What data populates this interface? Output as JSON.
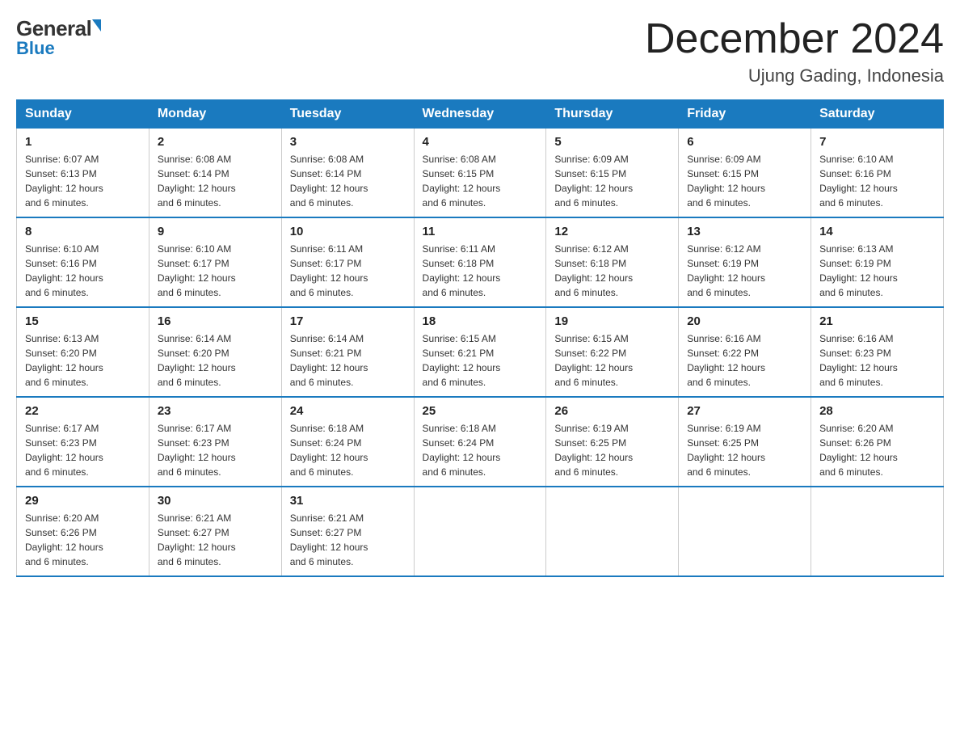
{
  "header": {
    "logo_top": "General",
    "logo_bottom": "Blue",
    "month_title": "December 2024",
    "location": "Ujung Gading, Indonesia"
  },
  "days_of_week": [
    "Sunday",
    "Monday",
    "Tuesday",
    "Wednesday",
    "Thursday",
    "Friday",
    "Saturday"
  ],
  "weeks": [
    [
      {
        "day": "1",
        "sunrise": "6:07 AM",
        "sunset": "6:13 PM",
        "daylight": "12 hours and 6 minutes."
      },
      {
        "day": "2",
        "sunrise": "6:08 AM",
        "sunset": "6:14 PM",
        "daylight": "12 hours and 6 minutes."
      },
      {
        "day": "3",
        "sunrise": "6:08 AM",
        "sunset": "6:14 PM",
        "daylight": "12 hours and 6 minutes."
      },
      {
        "day": "4",
        "sunrise": "6:08 AM",
        "sunset": "6:15 PM",
        "daylight": "12 hours and 6 minutes."
      },
      {
        "day": "5",
        "sunrise": "6:09 AM",
        "sunset": "6:15 PM",
        "daylight": "12 hours and 6 minutes."
      },
      {
        "day": "6",
        "sunrise": "6:09 AM",
        "sunset": "6:15 PM",
        "daylight": "12 hours and 6 minutes."
      },
      {
        "day": "7",
        "sunrise": "6:10 AM",
        "sunset": "6:16 PM",
        "daylight": "12 hours and 6 minutes."
      }
    ],
    [
      {
        "day": "8",
        "sunrise": "6:10 AM",
        "sunset": "6:16 PM",
        "daylight": "12 hours and 6 minutes."
      },
      {
        "day": "9",
        "sunrise": "6:10 AM",
        "sunset": "6:17 PM",
        "daylight": "12 hours and 6 minutes."
      },
      {
        "day": "10",
        "sunrise": "6:11 AM",
        "sunset": "6:17 PM",
        "daylight": "12 hours and 6 minutes."
      },
      {
        "day": "11",
        "sunrise": "6:11 AM",
        "sunset": "6:18 PM",
        "daylight": "12 hours and 6 minutes."
      },
      {
        "day": "12",
        "sunrise": "6:12 AM",
        "sunset": "6:18 PM",
        "daylight": "12 hours and 6 minutes."
      },
      {
        "day": "13",
        "sunrise": "6:12 AM",
        "sunset": "6:19 PM",
        "daylight": "12 hours and 6 minutes."
      },
      {
        "day": "14",
        "sunrise": "6:13 AM",
        "sunset": "6:19 PM",
        "daylight": "12 hours and 6 minutes."
      }
    ],
    [
      {
        "day": "15",
        "sunrise": "6:13 AM",
        "sunset": "6:20 PM",
        "daylight": "12 hours and 6 minutes."
      },
      {
        "day": "16",
        "sunrise": "6:14 AM",
        "sunset": "6:20 PM",
        "daylight": "12 hours and 6 minutes."
      },
      {
        "day": "17",
        "sunrise": "6:14 AM",
        "sunset": "6:21 PM",
        "daylight": "12 hours and 6 minutes."
      },
      {
        "day": "18",
        "sunrise": "6:15 AM",
        "sunset": "6:21 PM",
        "daylight": "12 hours and 6 minutes."
      },
      {
        "day": "19",
        "sunrise": "6:15 AM",
        "sunset": "6:22 PM",
        "daylight": "12 hours and 6 minutes."
      },
      {
        "day": "20",
        "sunrise": "6:16 AM",
        "sunset": "6:22 PM",
        "daylight": "12 hours and 6 minutes."
      },
      {
        "day": "21",
        "sunrise": "6:16 AM",
        "sunset": "6:23 PM",
        "daylight": "12 hours and 6 minutes."
      }
    ],
    [
      {
        "day": "22",
        "sunrise": "6:17 AM",
        "sunset": "6:23 PM",
        "daylight": "12 hours and 6 minutes."
      },
      {
        "day": "23",
        "sunrise": "6:17 AM",
        "sunset": "6:23 PM",
        "daylight": "12 hours and 6 minutes."
      },
      {
        "day": "24",
        "sunrise": "6:18 AM",
        "sunset": "6:24 PM",
        "daylight": "12 hours and 6 minutes."
      },
      {
        "day": "25",
        "sunrise": "6:18 AM",
        "sunset": "6:24 PM",
        "daylight": "12 hours and 6 minutes."
      },
      {
        "day": "26",
        "sunrise": "6:19 AM",
        "sunset": "6:25 PM",
        "daylight": "12 hours and 6 minutes."
      },
      {
        "day": "27",
        "sunrise": "6:19 AM",
        "sunset": "6:25 PM",
        "daylight": "12 hours and 6 minutes."
      },
      {
        "day": "28",
        "sunrise": "6:20 AM",
        "sunset": "6:26 PM",
        "daylight": "12 hours and 6 minutes."
      }
    ],
    [
      {
        "day": "29",
        "sunrise": "6:20 AM",
        "sunset": "6:26 PM",
        "daylight": "12 hours and 6 minutes."
      },
      {
        "day": "30",
        "sunrise": "6:21 AM",
        "sunset": "6:27 PM",
        "daylight": "12 hours and 6 minutes."
      },
      {
        "day": "31",
        "sunrise": "6:21 AM",
        "sunset": "6:27 PM",
        "daylight": "12 hours and 6 minutes."
      },
      null,
      null,
      null,
      null
    ]
  ],
  "labels": {
    "sunrise": "Sunrise:",
    "sunset": "Sunset:",
    "daylight": "Daylight:"
  },
  "colors": {
    "header_bg": "#1a7abf",
    "header_text": "#ffffff",
    "border": "#cccccc",
    "row_border": "#1a7abf"
  }
}
